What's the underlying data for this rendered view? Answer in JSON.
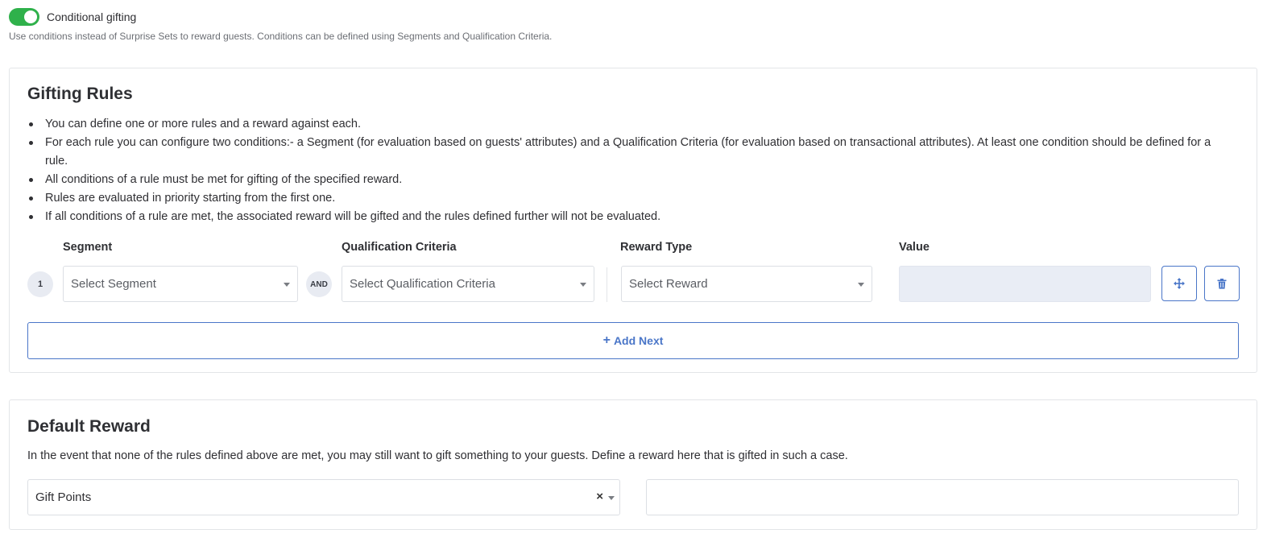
{
  "toggle": {
    "label": "Conditional gifting",
    "enabled": true,
    "description": "Use conditions instead of Surprise Sets to reward guests. Conditions can be defined using Segments and Qualification Criteria."
  },
  "gifting_rules": {
    "title": "Gifting Rules",
    "bullets": [
      "You can define one or more rules and a reward against each.",
      "For each rule you can configure two conditions:- a Segment (for evaluation based on guests' attributes) and a Qualification Criteria (for evaluation based on transactional attributes). At least one condition should be defined for a rule.",
      "All conditions of a rule must be met for gifting of the specified reward.",
      "Rules are evaluated in priority starting from the first one.",
      "If all conditions of a rule are met, the associated reward will be gifted and the rules defined further will not be evaluated."
    ],
    "columns": {
      "segment": "Segment",
      "qualification": "Qualification Criteria",
      "reward_type": "Reward Type",
      "value": "Value"
    },
    "rule": {
      "index": "1",
      "and_label": "AND",
      "segment_placeholder": "Select Segment",
      "qualification_placeholder": "Select Qualification Criteria",
      "reward_placeholder": "Select Reward",
      "value": ""
    },
    "add_next_label": "Add Next",
    "icons": {
      "move": "move-icon",
      "delete": "trash-icon",
      "add": "plus-icon"
    },
    "accent_color": "#4a76c8"
  },
  "default_reward": {
    "title": "Default Reward",
    "description": "In the event that none of the rules defined above are met, you may still want to gift something to your guests. Define a reward here that is gifted in such a case.",
    "selected_reward": "Gift Points",
    "clear_symbol": "×",
    "value": ""
  },
  "colors": {
    "toggle_on": "#2fb14b",
    "value_disabled": "#e9edf5"
  }
}
